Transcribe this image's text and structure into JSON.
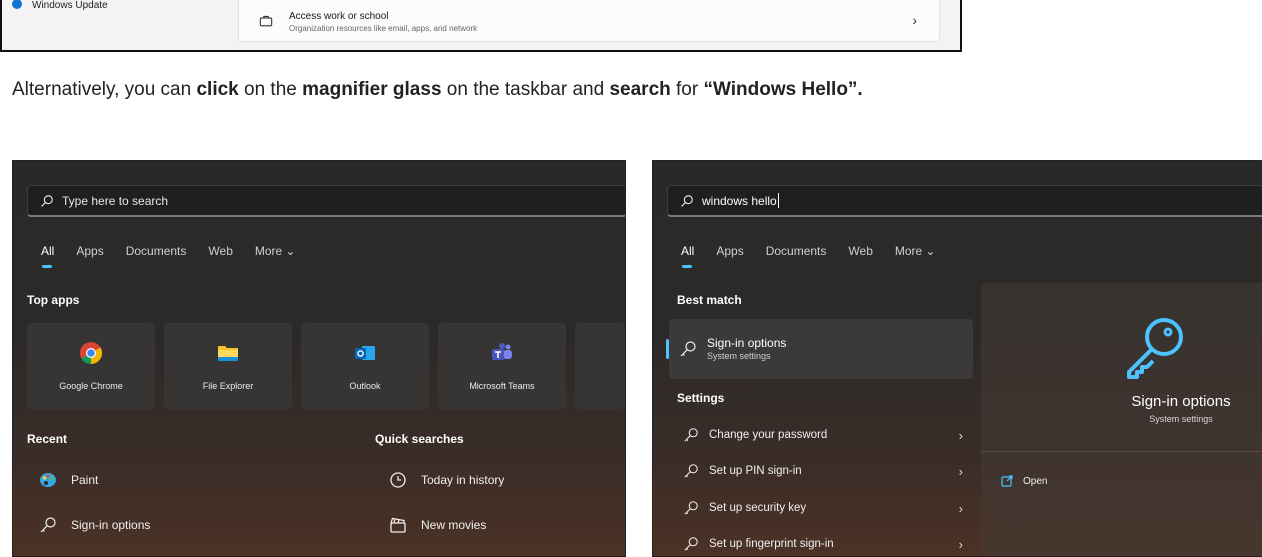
{
  "top": {
    "windows_update_label": "Windows Update",
    "card_title": "Access work or school",
    "card_subtitle": "Organization resources like email, apps, and network",
    "chevron": "›"
  },
  "instruction": {
    "t1": "Alternatively, you can ",
    "b1": "click",
    "t2": " on the ",
    "b2": "magnifier glass",
    "t3": " on the taskbar and ",
    "b3": "search",
    "t4": " for ",
    "b4": "“Windows Hello”."
  },
  "left_panel": {
    "search_placeholder": "Type here to search",
    "tabs": [
      "All",
      "Apps",
      "Documents",
      "Web",
      "More ⌄"
    ],
    "top_apps_heading": "Top apps",
    "apps": [
      "Google Chrome",
      "File Explorer",
      "Outlook",
      "Microsoft Teams"
    ],
    "recent_heading": "Recent",
    "recent": [
      "Paint",
      "Sign-in options"
    ],
    "quick_heading": "Quick searches",
    "quick": [
      "Today in history",
      "New movies"
    ]
  },
  "right_panel": {
    "search_value": "windows hello",
    "tabs": [
      "All",
      "Apps",
      "Documents",
      "Web",
      "More ⌄"
    ],
    "best_match_heading": "Best match",
    "best_title": "Sign-in options",
    "best_subtitle": "System settings",
    "settings_heading": "Settings",
    "settings": [
      "Change your password",
      "Set up PIN sign-in",
      "Set up security key",
      "Set up fingerprint sign-in"
    ],
    "chevron": "›",
    "detail_title": "Sign-in options",
    "detail_subtitle": "System settings",
    "open_label": "Open"
  },
  "colors": {
    "accent": "#4cc2ff",
    "panel_bg": "#2a2929"
  }
}
